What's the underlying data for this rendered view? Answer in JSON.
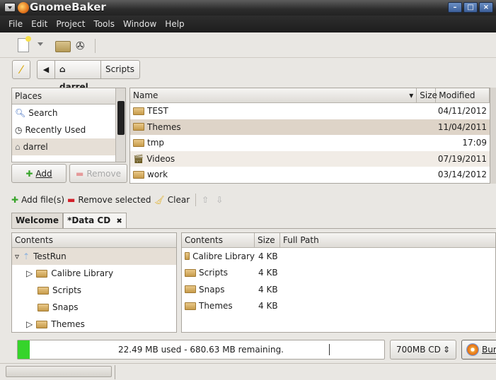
{
  "window": {
    "title": "GnomeBaker"
  },
  "menu": [
    "File",
    "Edit",
    "Project",
    "Tools",
    "Window",
    "Help"
  ],
  "pathbar": {
    "home_crumb": "darrel",
    "current_crumb": "Scripts"
  },
  "places": {
    "header": "Places",
    "items": [
      "Search",
      "Recently Used",
      "darrel"
    ],
    "add_label": "Add",
    "remove_label": "Remove"
  },
  "file_list": {
    "columns": {
      "name": "Name",
      "size": "Size",
      "modified": "Modified"
    },
    "rows": [
      {
        "name": "TEST",
        "modified": "04/11/2012"
      },
      {
        "name": "Themes",
        "modified": "11/04/2011"
      },
      {
        "name": "tmp",
        "modified": "17:09"
      },
      {
        "name": "Videos",
        "modified": "07/19/2011"
      },
      {
        "name": "work",
        "modified": "03/14/2012"
      }
    ]
  },
  "project_toolbar": {
    "add_files": "Add file(s)",
    "remove_selected": "Remove selected",
    "clear": "Clear"
  },
  "tabs": {
    "welcome": "Welcome",
    "data_cd": "*Data CD"
  },
  "tree": {
    "header": "Contents",
    "root": "TestRun",
    "children": [
      "Calibre Library",
      "Scripts",
      "Snaps",
      "Themes"
    ]
  },
  "contents": {
    "columns": {
      "contents": "Contents",
      "size": "Size",
      "path": "Full Path"
    },
    "rows": [
      {
        "name": "Calibre Library",
        "size": "4 KB"
      },
      {
        "name": "Scripts",
        "size": "4 KB"
      },
      {
        "name": "Snaps",
        "size": "4 KB"
      },
      {
        "name": "Themes",
        "size": "4 KB"
      }
    ]
  },
  "footer": {
    "usage_text": "22.49 MB used - 680.63 MB remaining.",
    "usage_fraction": 0.032,
    "disc_size": "700MB CD",
    "burn_label": "Burn"
  }
}
